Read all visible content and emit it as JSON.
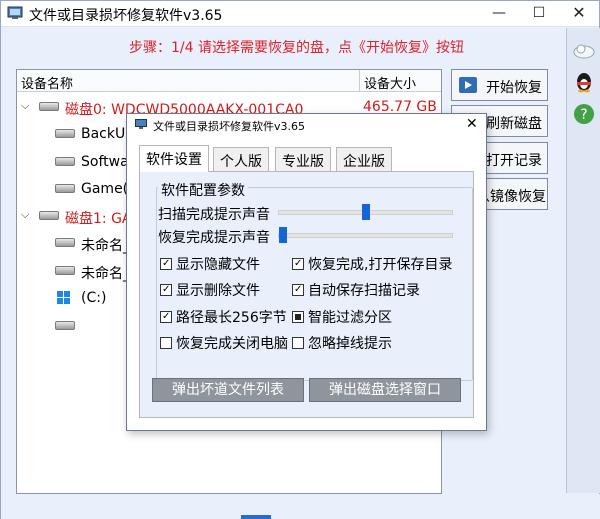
{
  "window": {
    "title": "文件或目录损坏修复软件v3.65",
    "min": "—",
    "max": "☐",
    "close": "✕"
  },
  "step_text": "步骤：1/4 请选择需要恢复的盘，点《开始恢复》按钮",
  "disk_list": {
    "col_name": "设备名称",
    "col_size": "设备大小",
    "rows": [
      {
        "label": "磁盘0: WDCWD5000AAKX-001CA0",
        "size": "465.77 GB"
      },
      {
        "label": "BackUP"
      },
      {
        "label": "Softwar"
      },
      {
        "label": "Game(F"
      },
      {
        "label": "磁盘1: GAL"
      },
      {
        "label": "未命名_"
      },
      {
        "label": "未命名_"
      },
      {
        "label": "(C:)"
      },
      {
        "label": ""
      }
    ]
  },
  "side_buttons": {
    "start": "开始恢复",
    "refresh": "刷新磁盘",
    "open": "打开记录",
    "image": "从镜像恢复"
  },
  "dialog": {
    "title": "文件或目录损坏修复软件v3.65",
    "close": "✕",
    "tabs": [
      "软件设置",
      "个人版",
      "专业版",
      "企业版"
    ],
    "group_title": "软件配置参数",
    "scan_sound_label": "扫描完成提示声音",
    "scan_sound_level": 0.5,
    "restore_sound_label": "恢复完成提示声音",
    "restore_sound_level": 0.0,
    "checks": [
      {
        "label": "显示隐藏文件",
        "state": "checked"
      },
      {
        "label": "恢复完成,打开保存目录",
        "state": "checked"
      },
      {
        "label": "显示删除文件",
        "state": "checked"
      },
      {
        "label": "自动保存扫描记录",
        "state": "checked"
      },
      {
        "label": "路径最长256字节",
        "state": "checked"
      },
      {
        "label": "智能过滤分区",
        "state": "indeterminate"
      },
      {
        "label": "恢复完成关闭电脑",
        "state": "unchecked"
      },
      {
        "label": "忽略掉线提示",
        "state": "unchecked"
      }
    ],
    "btn_bad_list": "弹出坏道文件列表",
    "btn_disk_window": "弹出磁盘选择窗口"
  },
  "colors": {
    "accent_red": "#d41b1b",
    "slider_blue": "#1565d8",
    "window_bg": "#e9f0fb"
  }
}
